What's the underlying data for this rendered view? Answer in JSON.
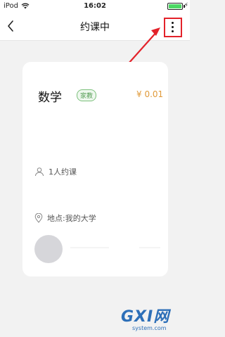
{
  "status_bar": {
    "carrier": "iPod",
    "time": "16:02",
    "battery_level": 1.0
  },
  "nav": {
    "title": "约课中"
  },
  "card": {
    "subject": "数学",
    "tag": "家教",
    "price": "¥ 0.01",
    "people": "1人约课",
    "place": "地点:我的大学"
  },
  "watermark": {
    "logo": "GXI网",
    "site": "system.com"
  },
  "colors": {
    "annotation": "#e3222a",
    "price": "#e09a3a",
    "tag": "#5aa05a",
    "background": "#f2f2f2"
  }
}
